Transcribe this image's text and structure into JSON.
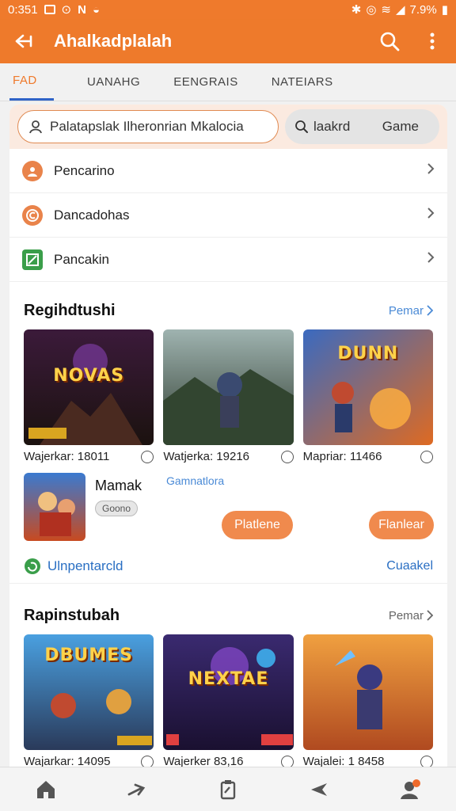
{
  "status": {
    "time": "0:351",
    "battery": "7.9%"
  },
  "app": {
    "title": "Ahalkadplalah"
  },
  "tabs": [
    {
      "label": "FAD",
      "active": true
    },
    {
      "label": "UANAHG"
    },
    {
      "label": "EENGRAIS"
    },
    {
      "label": "NATEIARS"
    }
  ],
  "search": {
    "placeholder": "Palatapslak Ilheronrian Mkalocia",
    "chip_label": "laakrd",
    "chip_game": "Game"
  },
  "menu": [
    {
      "label": "Pencarino",
      "icon": "user-circle-icon",
      "color": "#e9834a"
    },
    {
      "label": "Dancadohas",
      "icon": "copyright-icon",
      "color": "#e9834a"
    },
    {
      "label": "Pancakin",
      "icon": "box-check-icon",
      "color": "#3a9e4a"
    }
  ],
  "section1": {
    "title": "Regihdtushi",
    "more": "Pemar",
    "games": [
      {
        "caption": "Wajerkar: 18011",
        "art": "NOVAS",
        "theme": "dark-red"
      },
      {
        "caption": "Watjerka: 19216",
        "art": "",
        "theme": "forest"
      },
      {
        "caption": "Mapriar: 11466",
        "art": "DUNN",
        "theme": "fire"
      }
    ]
  },
  "featured": {
    "title": "Mamak",
    "badge": "Goono",
    "subtitle": "Gamnatlora",
    "button1": "Platlene",
    "button2": "Flanlear"
  },
  "footer_row": {
    "left": "Ulnpentarcld",
    "right": "Cuaakel"
  },
  "section2": {
    "title": "Rapinstubah",
    "more": "Pemar",
    "games": [
      {
        "caption": "Wajarkar: 14095",
        "art": "DBUMES",
        "theme": "sky"
      },
      {
        "caption": "Wajerker 83,16",
        "art": "NEXTAE",
        "theme": "purple"
      },
      {
        "caption": "Wajalei: 1 8458",
        "art": "",
        "theme": "sunset"
      }
    ]
  },
  "colors": {
    "accent": "#ee7a2b",
    "link": "#4a8ad6",
    "tab_underline": "#2f63c7"
  }
}
